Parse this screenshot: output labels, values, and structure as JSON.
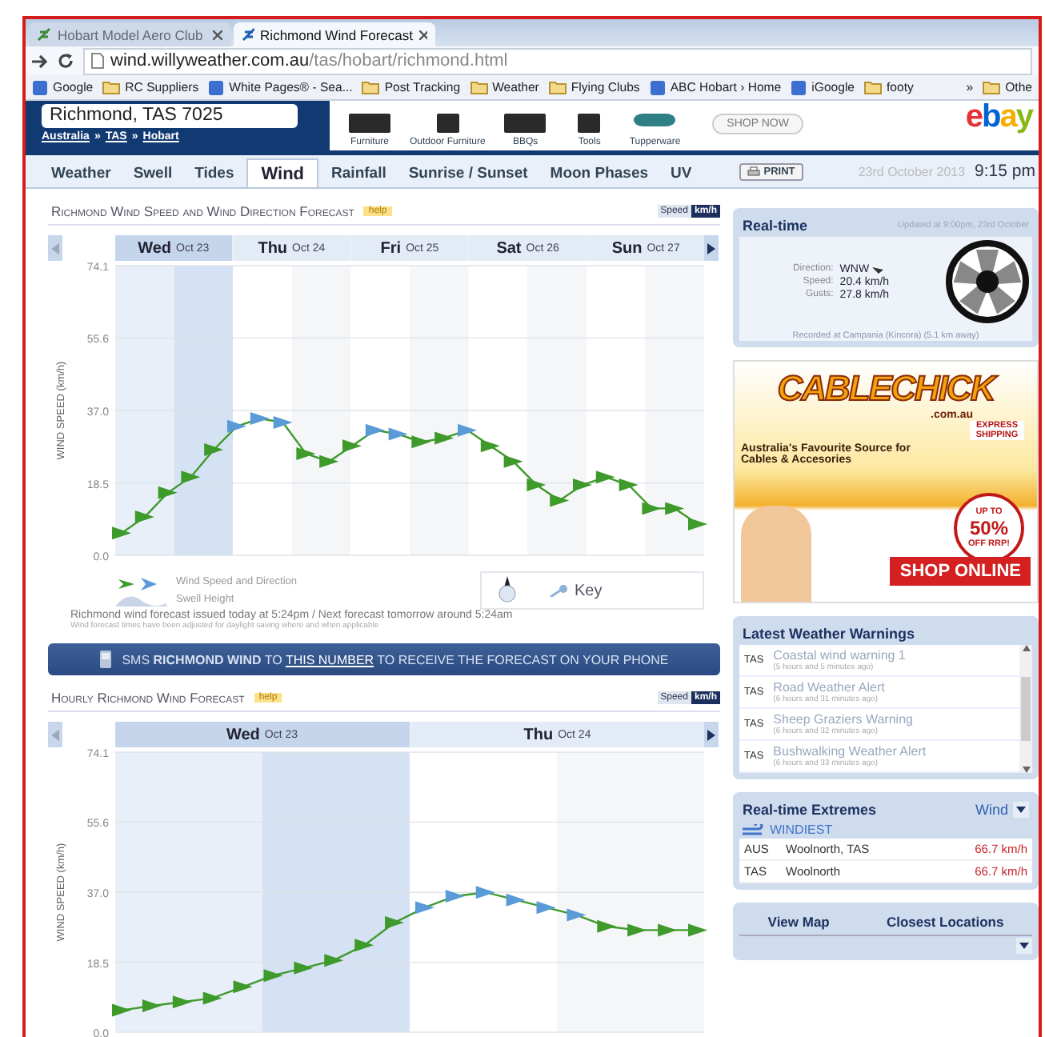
{
  "browser": {
    "tabs": [
      {
        "title": "Hobart Model Aero Club",
        "selected": false
      },
      {
        "title": "Richmond Wind Forecast",
        "selected": true
      }
    ],
    "url_host": "wind.willyweather.com.au",
    "url_path": "/tas/hobart/richmond.html",
    "bookmarks": [
      {
        "label": "Google",
        "kind": "site"
      },
      {
        "label": "RC Suppliers",
        "kind": "folder"
      },
      {
        "label": "White Pages® - Sea...",
        "kind": "site"
      },
      {
        "label": "Post Tracking",
        "kind": "folder"
      },
      {
        "label": "Weather",
        "kind": "folder"
      },
      {
        "label": "Flying Clubs",
        "kind": "folder"
      },
      {
        "label": "ABC Hobart › Home",
        "kind": "site"
      },
      {
        "label": "iGoogle",
        "kind": "site"
      },
      {
        "label": "footy",
        "kind": "folder"
      }
    ],
    "overflow": "»",
    "other": "Othe"
  },
  "header": {
    "location": "Richmond, TAS 7025",
    "breadcrumb": [
      "Australia",
      "TAS",
      "Hobart"
    ],
    "breadcrumb_separator": "»",
    "ad": {
      "products": [
        "Furniture",
        "Outdoor Furniture",
        "BBQs",
        "Tools",
        "Tupperware"
      ],
      "button": "SHOP NOW",
      "logo": "ebay"
    }
  },
  "nav": {
    "tabs": [
      {
        "label": "Weather",
        "selected": false
      },
      {
        "label": "Swell",
        "selected": false
      },
      {
        "label": "Tides",
        "selected": false
      },
      {
        "label": "Wind",
        "selected": true
      },
      {
        "label": "Rainfall",
        "selected": false
      },
      {
        "label": "Sunrise / Sunset",
        "selected": false
      },
      {
        "label": "Moon Phases",
        "selected": false
      },
      {
        "label": "UV",
        "selected": false
      }
    ],
    "print": "PRINT",
    "date": "23rd October 2013",
    "time": "9:15 pm"
  },
  "forecast_chart": {
    "title": "Richmond Wind Speed and Wind Direction Forecast",
    "help": "help",
    "speed_label": "Speed",
    "unit": "km/h",
    "days": [
      {
        "day": "Wed",
        "date": "Oct 23",
        "selected": true
      },
      {
        "day": "Thu",
        "date": "Oct 24",
        "selected": false
      },
      {
        "day": "Fri",
        "date": "Oct 25",
        "selected": false
      },
      {
        "day": "Sat",
        "date": "Oct 26",
        "selected": false
      },
      {
        "day": "Sun",
        "date": "Oct 27",
        "selected": false
      }
    ],
    "chart_data": {
      "type": "line",
      "ylabel": "WIND SPEED (km/h)",
      "ylim": [
        0,
        74.1
      ],
      "yticks": [
        {
          "value": 0,
          "label": "0.0"
        },
        {
          "value": 18.5,
          "label": "18.5"
        },
        {
          "value": 37,
          "label": "37.0"
        },
        {
          "value": 55.6,
          "label": "55.6"
        },
        {
          "value": 74.1,
          "label": "74.1"
        }
      ],
      "grid": true,
      "series": [
        {
          "color": "#3f9a2c",
          "marker": "triangle",
          "values": [
            5.7,
            9.8,
            16,
            20,
            27,
            33,
            35,
            34,
            26,
            24,
            28,
            32,
            31,
            29,
            30,
            32,
            28,
            24,
            18,
            14,
            18,
            20,
            18,
            12,
            12,
            8
          ]
        }
      ]
    },
    "legend": [
      "Wind Speed and Direction",
      "Swell Height"
    ],
    "key": "Key",
    "issued": "Richmond wind forecast issued today at 5:24pm / Next forecast tomorrow around 5:24am",
    "note": "Wind forecast times have been adjusted for daylight saving where and when applicable"
  },
  "sms_banner": {
    "before": "SMS **RICHMOND WIND** TO",
    "link": "THIS NUMBER",
    "after": "TO RECEIVE THE FORECAST ON YOUR PHONE"
  },
  "hourly_chart": {
    "title": "Hourly Richmond Wind Forecast",
    "help": "help",
    "speed_label": "Speed",
    "unit": "km/h",
    "days": [
      {
        "day": "Wed",
        "date": "Oct 23",
        "selected": true
      },
      {
        "day": "Thu",
        "date": "Oct 24",
        "selected": false
      }
    ],
    "chart_data": {
      "type": "line",
      "ylabel": "WIND SPEED (km/h)",
      "ylim": [
        0,
        74.1
      ],
      "yticks": [
        {
          "value": 0,
          "label": "0.0"
        },
        {
          "value": 18.5,
          "label": "18.5"
        },
        {
          "value": 37,
          "label": "37.0"
        },
        {
          "value": 55.6,
          "label": "55.6"
        },
        {
          "value": 74.1,
          "label": "74.1"
        }
      ],
      "grid": true,
      "series": [
        {
          "color": "#3f9a2c",
          "marker": "triangle",
          "values": [
            5.8,
            7,
            8,
            9,
            12,
            15,
            17,
            19,
            23,
            29,
            33,
            36,
            37,
            35,
            33,
            31,
            28,
            27,
            27,
            27
          ]
        }
      ]
    }
  },
  "realtime": {
    "title": "Real-time",
    "updated": "Updated at 9:00pm, 23rd October",
    "rows": [
      {
        "label": "Direction:",
        "value": "WNW"
      },
      {
        "label": "Speed:",
        "value": "20.4 km/h"
      },
      {
        "label": "Gusts:",
        "value": "27.8 km/h"
      }
    ],
    "recorded": "Recorded at Campania (Kincora) (5.1 km away)"
  },
  "ad": {
    "brand": "CABLECHICK",
    "domain": ".com.au",
    "tagline": "Australia's Favourite Source for Cables & Accesories",
    "shipping": "EXPRESS SHIPPING",
    "discount_top": "UP TO",
    "discount": "50%",
    "discount_bottom": "OFF RRP!",
    "cta": "SHOP ONLINE"
  },
  "warnings": {
    "title": "Latest Weather Warnings",
    "items": [
      {
        "state": "TAS",
        "title": "Coastal wind warning 1",
        "age": "(5 hours and 5 minutes ago)"
      },
      {
        "state": "TAS",
        "title": "Road Weather Alert",
        "age": "(6 hours and 31 minutes ago)"
      },
      {
        "state": "TAS",
        "title": "Sheep Graziers Warning",
        "age": "(6 hours and 32 minutes ago)"
      },
      {
        "state": "TAS",
        "title": "Bushwalking Weather Alert",
        "age": "(6 hours and 33 minutes ago)"
      }
    ]
  },
  "extremes": {
    "title": "Real-time Extremes",
    "selector": "Wind",
    "category": "WINDIEST",
    "rows": [
      {
        "region": "AUS",
        "place": "Woolnorth, TAS",
        "value": "66.7 km/h"
      },
      {
        "region": "TAS",
        "place": "Woolnorth",
        "value": "66.7 km/h"
      }
    ]
  },
  "locations": {
    "tabs": [
      "View Map",
      "Closest Locations"
    ]
  }
}
